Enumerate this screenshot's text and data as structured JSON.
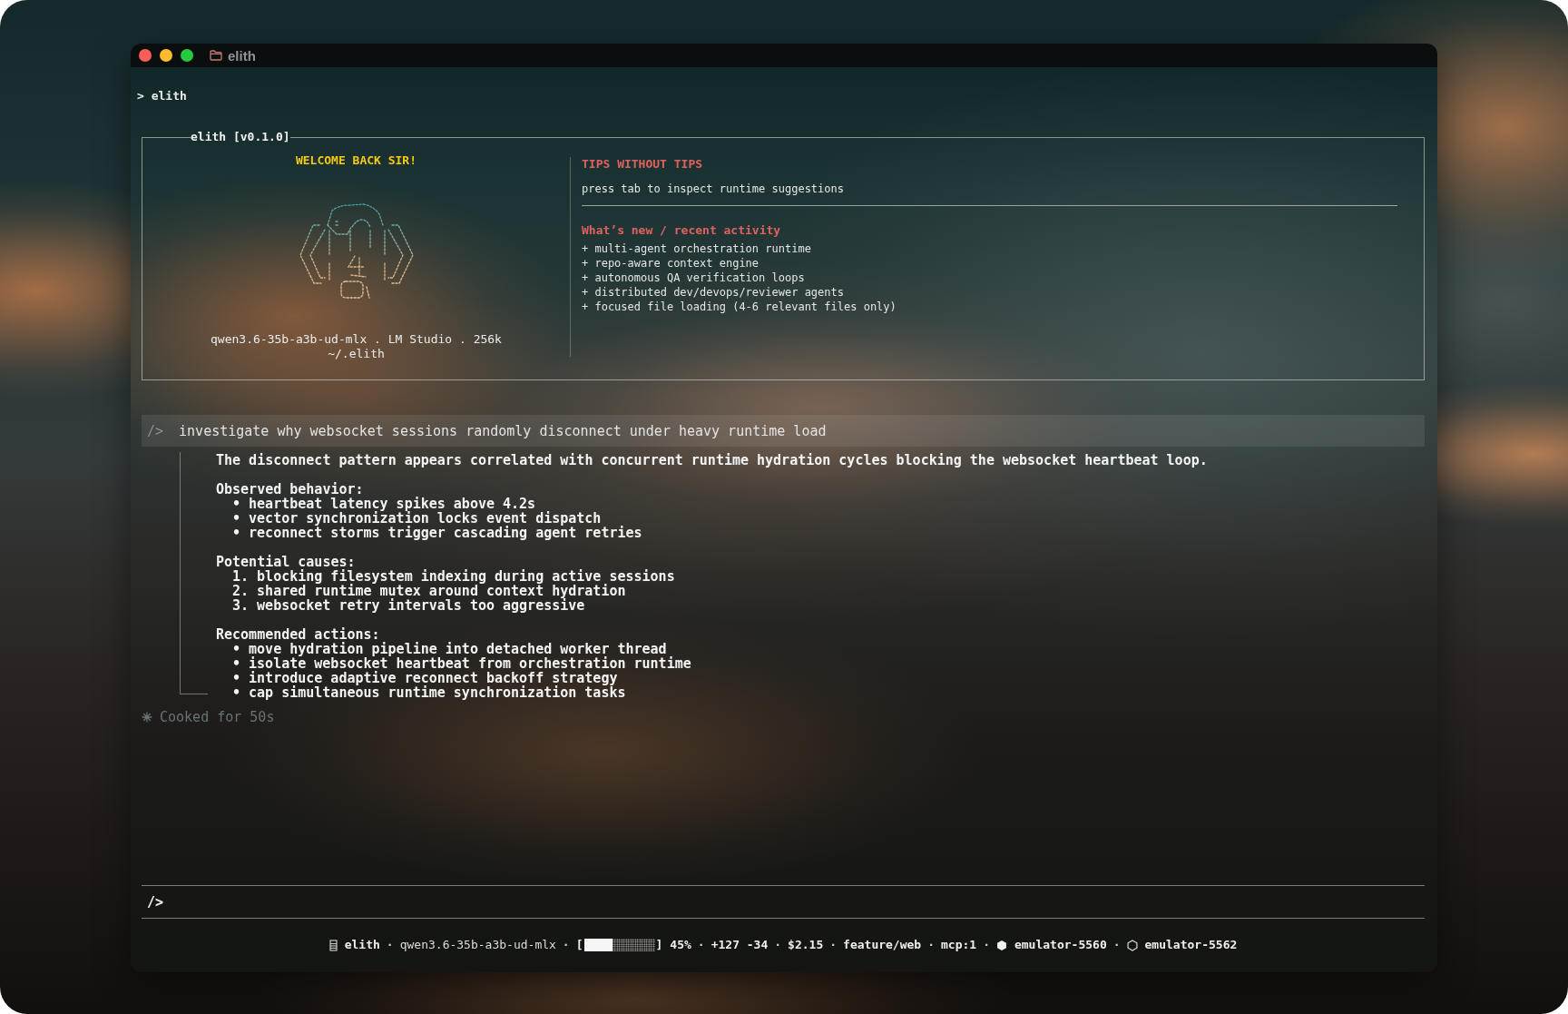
{
  "window": {
    "title": "elith"
  },
  "command": "> elith",
  "welcome_panel": {
    "title": "elith [v0.1.0]",
    "greeting": "WELCOME BACK SIR!",
    "model_info": "qwen3.6-35b-a3b-ud-mlx . LM Studio . 256k",
    "path": "~/.elith",
    "tips": {
      "heading": "TIPS WITHOUT TIPS",
      "text": "press tab to inspect runtime suggestions"
    },
    "activity": {
      "heading": "What’s new / recent activity",
      "items": [
        "+ multi-agent orchestration runtime",
        "+ repo-aware context engine",
        "+ autonomous QA verification loops",
        "+ distributed dev/devops/reviewer agents",
        "+ focused file loading (4-6 relevant files only)"
      ]
    }
  },
  "conversation": {
    "prompt_marker": "/>",
    "message": "investigate why websocket sessions randomly disconnect under heavy runtime load",
    "response": {
      "summary": "The disconnect pattern appears correlated with concurrent runtime hydration cycles blocking the websocket heartbeat loop.",
      "sections": [
        {
          "heading": "Observed behavior:",
          "items": [
            "• heartbeat latency spikes above 4.2s",
            "• vector synchronization locks event dispatch",
            "• reconnect storms trigger cascading agent retries"
          ]
        },
        {
          "heading": "Potential causes:",
          "items": [
            "1. blocking filesystem indexing during active sessions",
            "2. shared runtime mutex around context hydration",
            "3. websocket retry intervals too aggressive"
          ]
        },
        {
          "heading": "Recommended actions:",
          "items": [
            "• move hydration pipeline into detached worker thread",
            "• isolate websocket heartbeat from orchestration runtime",
            "• introduce adaptive reconnect backoff strategy",
            "• cap simultaneous runtime synchronization tasks"
          ]
        }
      ]
    },
    "status": "Cooked for 50s"
  },
  "input": {
    "prompt_marker": "/>"
  },
  "status_bar": [
    {
      "kind": "app",
      "text": "elith"
    },
    {
      "kind": "separator",
      "text": "·"
    },
    {
      "kind": "model",
      "text": "qwen3.6-35b-a3b-ud-mlx"
    },
    {
      "kind": "separator",
      "text": "·"
    },
    {
      "kind": "meter",
      "open": "[",
      "close": "]",
      "level": 0.4,
      "reading": "45%"
    },
    {
      "kind": "separator",
      "text": "·"
    },
    {
      "kind": "diff",
      "text": "+127 -34"
    },
    {
      "kind": "separator",
      "text": "·"
    },
    {
      "kind": "cost",
      "text": "$2.15"
    },
    {
      "kind": "separator",
      "text": "·"
    },
    {
      "kind": "branch",
      "text": "feature/web"
    },
    {
      "kind": "separator",
      "text": "·"
    },
    {
      "kind": "mcp",
      "text": "mcp:1"
    },
    {
      "kind": "separator",
      "text": "·"
    },
    {
      "kind": "device",
      "text": "emulator-5560",
      "connected": true
    },
    {
      "kind": "separator",
      "text": "·"
    },
    {
      "kind": "device",
      "text": "emulator-5562",
      "connected": false
    }
  ]
}
